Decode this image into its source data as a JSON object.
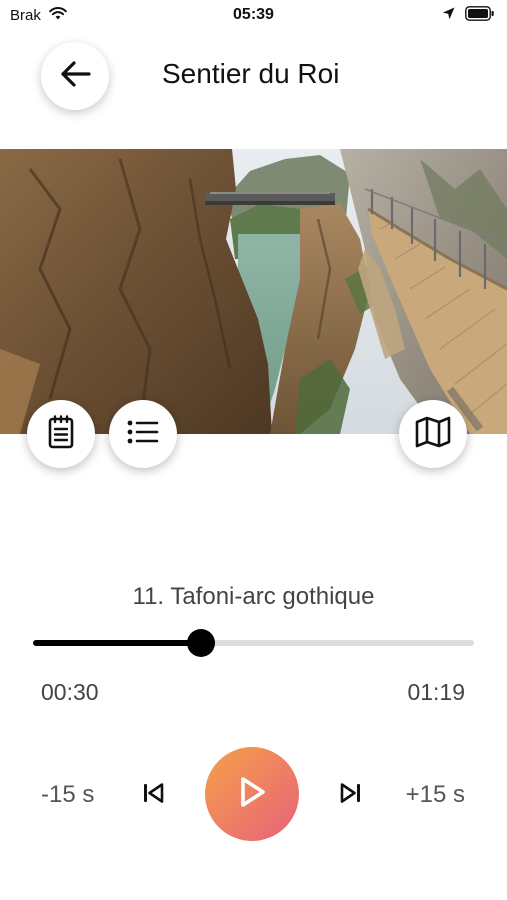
{
  "status_bar": {
    "carrier": "Brak",
    "time": "05:39"
  },
  "header": {
    "title": "Sentier du Roi"
  },
  "hero": {
    "subject": "gorge with suspended bridge and cliffside boardwalk"
  },
  "actions": {
    "notes_icon": "notes-icon",
    "list_icon": "list-icon",
    "map_icon": "map-icon"
  },
  "player": {
    "track_title": "11. Tafoni-arc gothique",
    "elapsed": "00:30",
    "total": "01:19",
    "progress": 0.38,
    "rewind_label": "-15 s",
    "forward_label": "+15 s",
    "accent_start": "#f5a04a",
    "accent_end": "#e8627a"
  }
}
